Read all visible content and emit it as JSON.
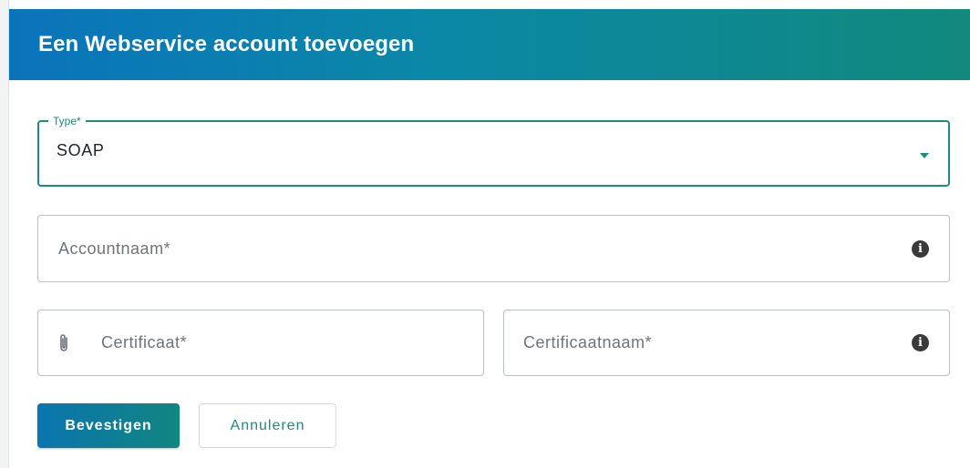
{
  "dialog": {
    "title": "Een Webservice account toevoegen"
  },
  "form": {
    "type": {
      "label": "Type*",
      "value": "SOAP",
      "icon": "chevron-down-icon"
    },
    "account_name": {
      "placeholder": "Accountnaam*",
      "icon": "info-icon"
    },
    "certificate": {
      "placeholder": "Certificaat*",
      "icon": "paperclip-icon"
    },
    "certificate_name": {
      "placeholder": "Certificaatnaam*",
      "icon": "info-icon"
    }
  },
  "actions": {
    "confirm_label": "Bevestigen",
    "cancel_label": "Annuleren"
  },
  "colors": {
    "header_gradient_start": "#0a74bb",
    "header_gradient_end": "#11897d",
    "accent": "#1b8d82"
  }
}
